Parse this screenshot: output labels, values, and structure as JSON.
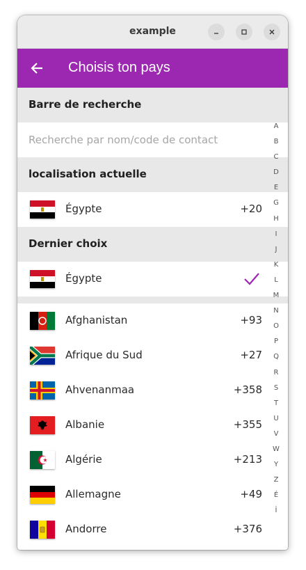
{
  "window": {
    "title": "example"
  },
  "appbar": {
    "title": "Choisis ton pays"
  },
  "sections": {
    "search": "Barre de recherche",
    "current": "localisation actuelle",
    "last": "Dernier choix"
  },
  "search": {
    "placeholder": "Recherche par nom/code de contact",
    "value": ""
  },
  "current_location": {
    "name": "Égypte",
    "code": "+20",
    "flag": "egypt-flag"
  },
  "last_choice": {
    "name": "Égypte",
    "flag": "egypt-flag",
    "selected_icon": "check-icon",
    "check_color": "#9c27b0"
  },
  "countries": [
    {
      "name": "Afghanistan",
      "code": "+93",
      "flag": "afghanistan-flag"
    },
    {
      "name": "Afrique du Sud",
      "code": "+27",
      "flag": "south-africa-flag"
    },
    {
      "name": "Ahvenanmaa",
      "code": "+358",
      "flag": "aland-flag"
    },
    {
      "name": "Albanie",
      "code": "+355",
      "flag": "albania-flag"
    },
    {
      "name": "Algérie",
      "code": "+213",
      "flag": "algeria-flag"
    },
    {
      "name": "Allemagne",
      "code": "+49",
      "flag": "germany-flag"
    },
    {
      "name": "Andorre",
      "code": "+376",
      "flag": "andorra-flag"
    }
  ],
  "alphabet_index": [
    "A",
    "B",
    "C",
    "D",
    "E",
    "G",
    "H",
    "I",
    "J",
    "K",
    "L",
    "M",
    "N",
    "O",
    "P",
    "Q",
    "R",
    "S",
    "T",
    "U",
    "V",
    "W",
    "Y",
    "Z",
    "É",
    "İ"
  ],
  "colors": {
    "accent": "#9c27b0",
    "section_bg": "#e8e8e8"
  }
}
